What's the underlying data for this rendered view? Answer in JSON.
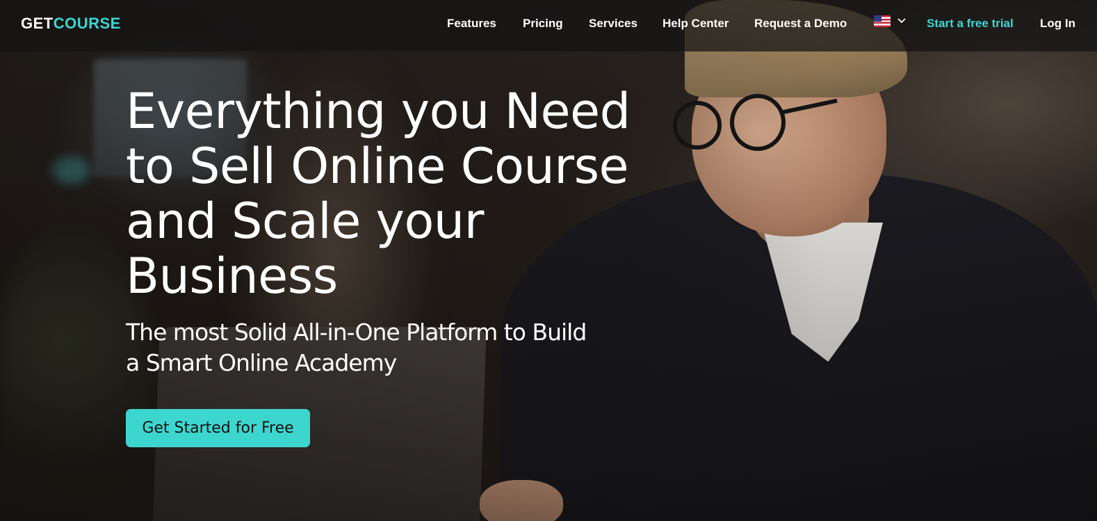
{
  "brand": {
    "logo_part1": "GET",
    "logo_part2": "COURSE",
    "accent_color": "#3dd6cf"
  },
  "nav": {
    "items": [
      {
        "label": "Features"
      },
      {
        "label": "Pricing"
      },
      {
        "label": "Services"
      },
      {
        "label": "Help Center"
      },
      {
        "label": "Request a Demo"
      }
    ],
    "language": {
      "icon": "us-flag-icon",
      "dropdown_icon": "chevron-down-icon"
    },
    "trial_label": "Start a free trial",
    "login_label": "Log In"
  },
  "hero": {
    "headline": "Everything you Need\nto Sell Online Course\nand Scale your\nBusiness",
    "subheadline": "The most Solid All-in-One Platform to Build\na Smart Online Academy",
    "cta_label": "Get Started for Free",
    "image": "man-working-on-laptop-at-night"
  }
}
